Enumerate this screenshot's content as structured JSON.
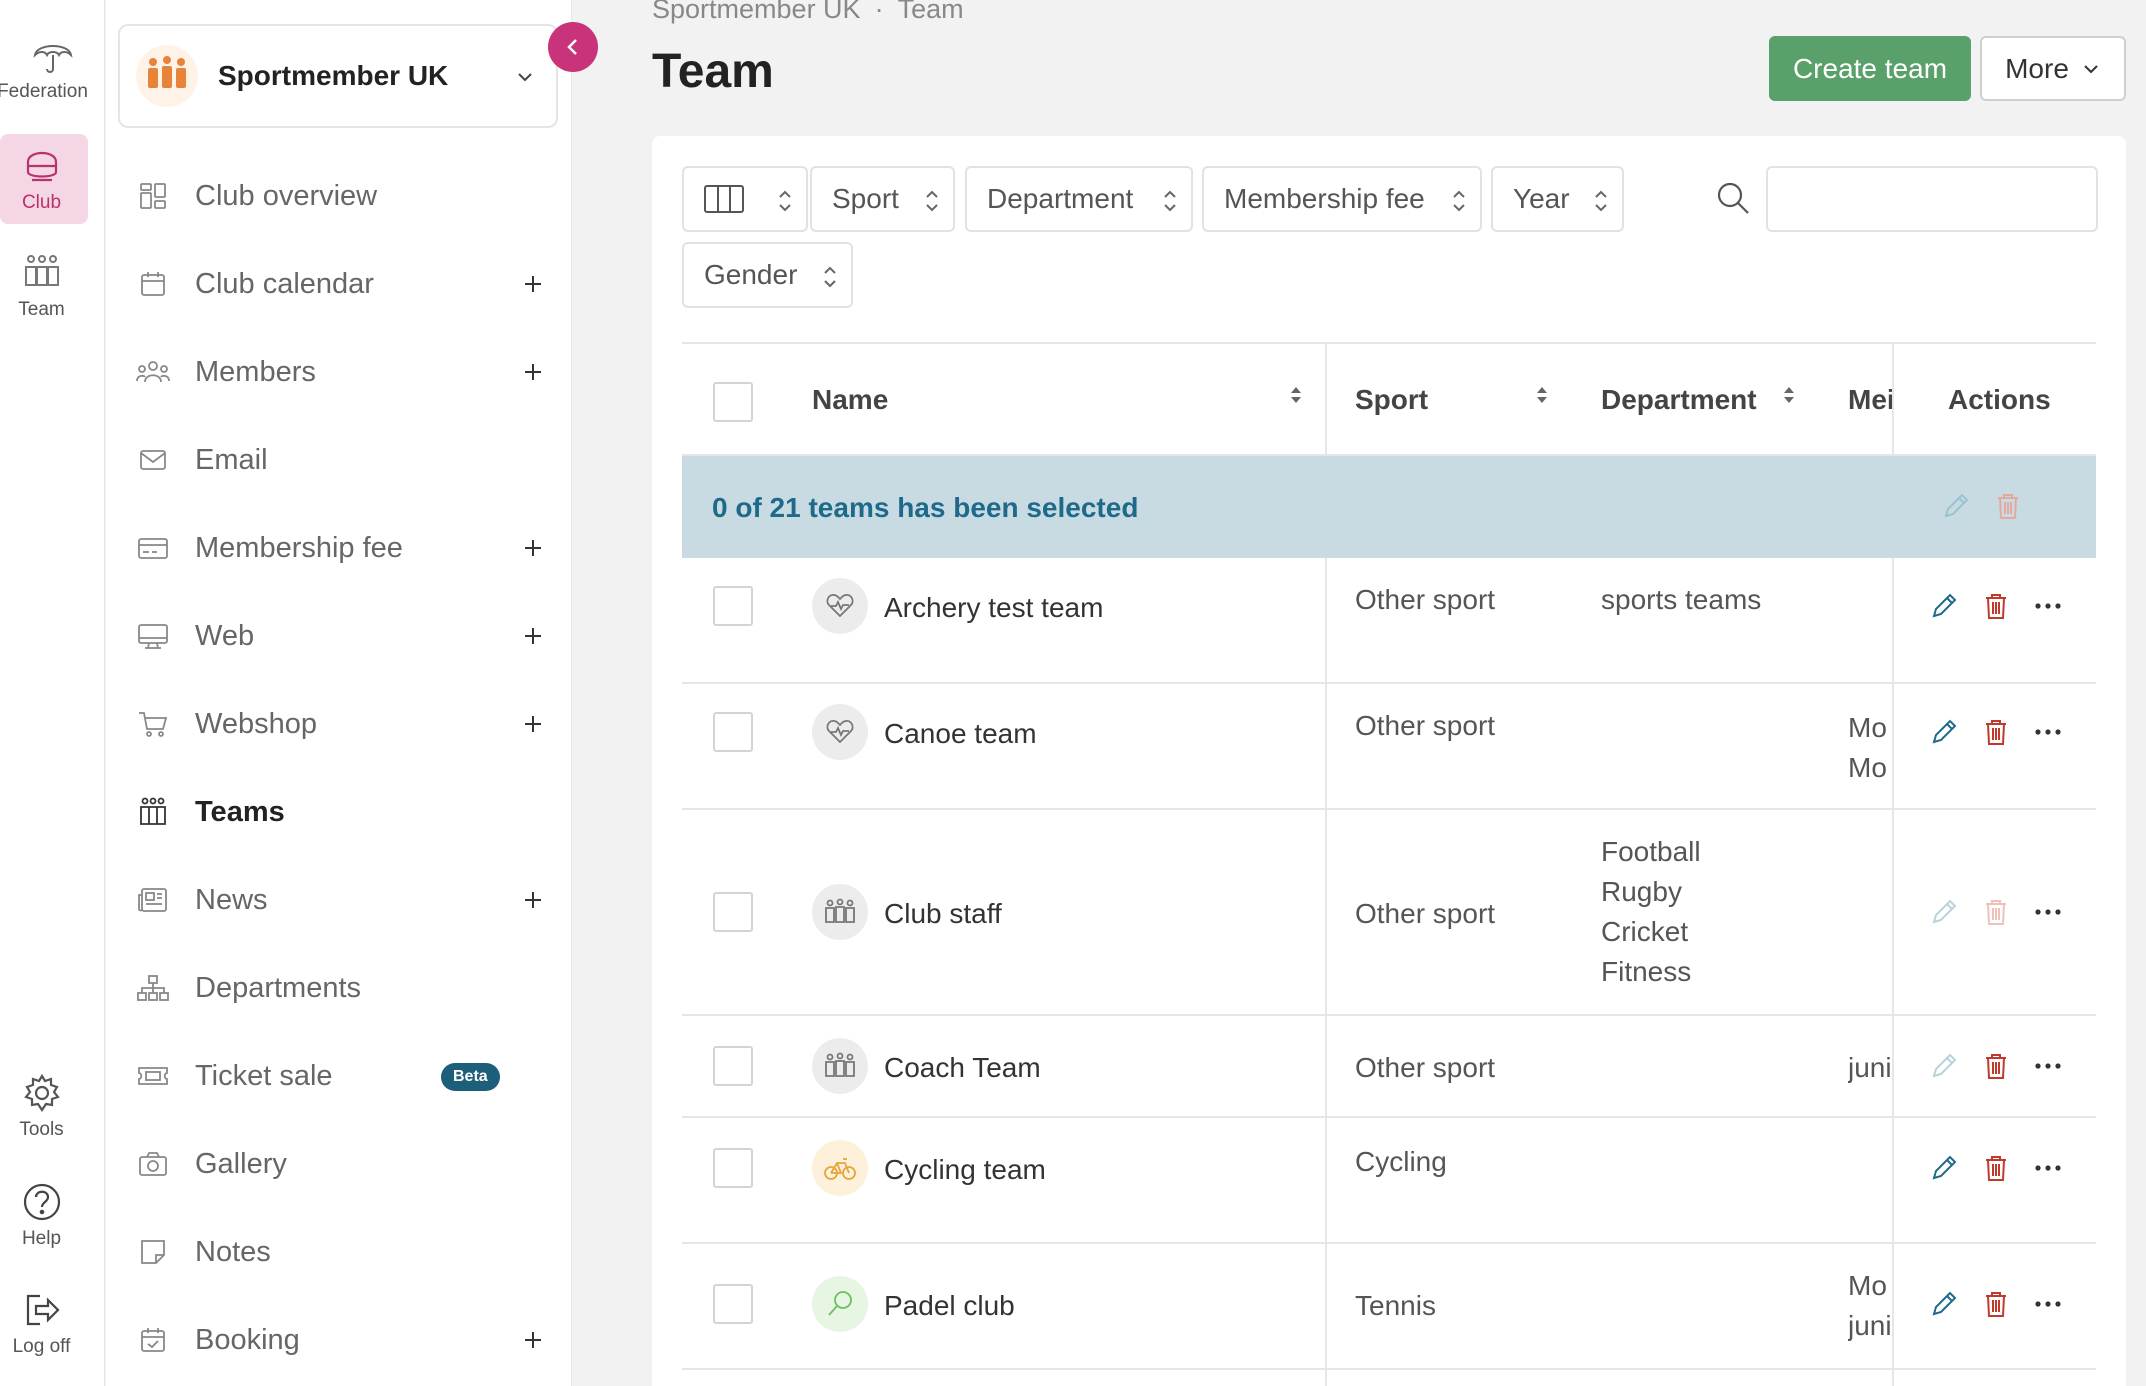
{
  "rail": {
    "items": [
      {
        "label": "Federation",
        "icon": "umbrella-icon"
      },
      {
        "label": "Club",
        "icon": "club-icon",
        "active": true
      },
      {
        "label": "Team",
        "icon": "team-icon"
      },
      {
        "label": "Tools",
        "icon": "gear-icon"
      },
      {
        "label": "Help",
        "icon": "help-icon"
      },
      {
        "label": "Log off",
        "icon": "logout-icon"
      }
    ]
  },
  "sidebar": {
    "club_name": "Sportmember UK",
    "items": [
      {
        "label": "Club overview",
        "icon": "grid-icon",
        "plus": false
      },
      {
        "label": "Club calendar",
        "icon": "calendar-icon",
        "plus": true
      },
      {
        "label": "Members",
        "icon": "members-icon",
        "plus": true
      },
      {
        "label": "Email",
        "icon": "envelope-icon",
        "plus": false
      },
      {
        "label": "Membership fee",
        "icon": "card-icon",
        "plus": true
      },
      {
        "label": "Web",
        "icon": "monitor-icon",
        "plus": true
      },
      {
        "label": "Webshop",
        "icon": "cart-icon",
        "plus": true
      },
      {
        "label": "Teams",
        "icon": "teams-icon",
        "plus": false,
        "active": true
      },
      {
        "label": "News",
        "icon": "newspaper-icon",
        "plus": true
      },
      {
        "label": "Departments",
        "icon": "hierarchy-icon",
        "plus": false
      },
      {
        "label": "Ticket sale",
        "icon": "ticket-icon",
        "plus": false,
        "badge": "Beta"
      },
      {
        "label": "Gallery",
        "icon": "camera-icon",
        "plus": false
      },
      {
        "label": "Notes",
        "icon": "note-icon",
        "plus": false
      },
      {
        "label": "Booking",
        "icon": "booking-icon",
        "plus": true
      }
    ]
  },
  "header": {
    "breadcrumb": [
      "Sportmember UK",
      "·",
      "Team"
    ],
    "title": "Team",
    "create_label": "Create team",
    "more_label": "More"
  },
  "filters": {
    "items": [
      "Sport",
      "Department",
      "Membership fee",
      "Year",
      "Gender"
    ],
    "search_placeholder": ""
  },
  "table": {
    "columns": [
      "Name",
      "Sport",
      "Department",
      "Mei",
      "Actions"
    ],
    "selection_text": "0 of 21 teams has been selected",
    "rows": [
      {
        "name": "Archery test team",
        "sport": "Other sport",
        "department": [
          "sports teams"
        ],
        "membership": [],
        "avatar": "heartbeat-icon",
        "edit_enabled": true,
        "delete_enabled": true
      },
      {
        "name": "Canoe team",
        "sport": "Other sport",
        "department": [],
        "membership": [
          "Mo",
          "Mo"
        ],
        "avatar": "heartbeat-icon",
        "edit_enabled": true,
        "delete_enabled": true
      },
      {
        "name": "Club staff",
        "sport": "Other sport",
        "department": [
          "Football",
          "Rugby",
          "Cricket",
          "Fitness"
        ],
        "membership": [],
        "avatar": "group-icon",
        "edit_enabled": false,
        "delete_enabled": false
      },
      {
        "name": "Coach Team",
        "sport": "Other sport",
        "department": [],
        "membership": [
          "juni"
        ],
        "avatar": "group-icon",
        "edit_enabled": false,
        "delete_enabled": true
      },
      {
        "name": "Cycling team",
        "sport": "Cycling",
        "department": [],
        "membership": [],
        "avatar": "bicycle-icon",
        "edit_enabled": true,
        "delete_enabled": true
      },
      {
        "name": "Padel club",
        "sport": "Tennis",
        "department": [],
        "membership": [
          "Mo",
          "juni"
        ],
        "avatar": "racket-icon",
        "edit_enabled": true,
        "delete_enabled": true
      }
    ]
  },
  "colors": {
    "accent": "#c9337a",
    "primary_button": "#5aa06a",
    "selection_bar": "#c8dbe3",
    "selection_text": "#1f6a8a",
    "edit_icon": "#1f6a8a",
    "delete_icon": "#c0392b"
  }
}
